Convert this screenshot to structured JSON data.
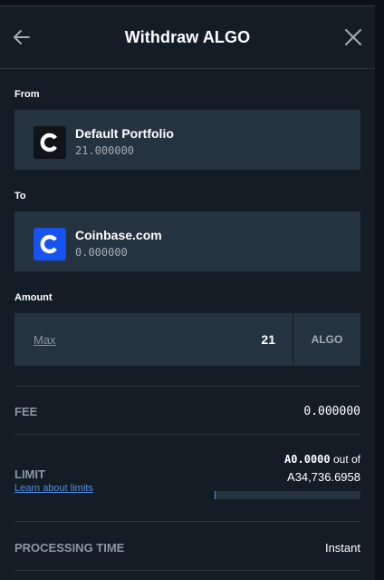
{
  "header": {
    "title": "Withdraw ALGO",
    "back_icon": "arrow-left-icon",
    "close_icon": "close-icon"
  },
  "from": {
    "label": "From",
    "wallet_name": "Default Portfolio",
    "balance": "21.000000",
    "icon": "coinbase-logo-dark"
  },
  "to": {
    "label": "To",
    "wallet_name": "Coinbase.com",
    "balance": "0.000000",
    "icon": "coinbase-logo-blue"
  },
  "amount": {
    "label": "Amount",
    "max_label": "Max",
    "value": "21",
    "unit": "ALGO"
  },
  "fee": {
    "label": "FEE",
    "value": "0.000000"
  },
  "limit": {
    "label": "LIMIT",
    "used": "A0.0000",
    "out_of_text": "out of",
    "total": "A34,736.6958",
    "learn_link": "Learn about limits",
    "progress_fraction": 0
  },
  "processing": {
    "label": "PROCESSING TIME",
    "value": "Instant"
  },
  "colors": {
    "panel_bg": "#141d26",
    "card_bg": "#25323f",
    "accent_blue": "#4d8fe8",
    "coinbase_blue": "#1652f0",
    "muted_text": "#8a96a3"
  }
}
